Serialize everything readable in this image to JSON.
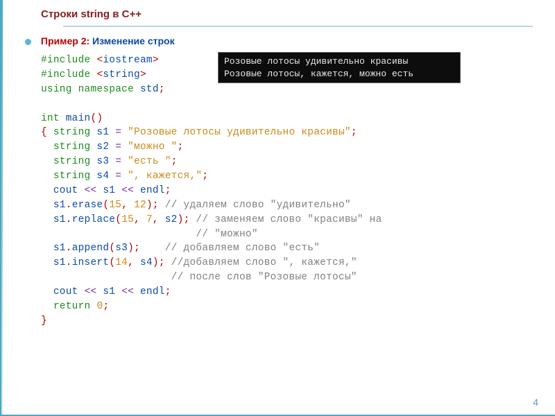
{
  "header": {
    "title": "Строки  string в С++"
  },
  "subtitle": {
    "label": "Пример 2:",
    "text": " Изменение строк"
  },
  "console": {
    "line1": "Розовые лотосы удивительно красивы",
    "line2": "Розовые лотосы, кажется, можно есть"
  },
  "code": {
    "l01_inc": "#include ",
    "l01_lt": "<",
    "l01_hdr": "iostream",
    "l01_gt": ">",
    "l02_inc": "#include ",
    "l02_lt": "<",
    "l02_hdr": "string",
    "l02_gt": ">",
    "l03_using": "using namespace ",
    "l03_std": "std",
    "l03_semi": ";",
    "l05_int": "int ",
    "l05_main": "main",
    "l05_paren": "()",
    "l06_br": "{ ",
    "l06_str": "string",
    "l06_s1": " s1 ",
    "l06_eq": "=",
    "l06_lit": " \"Розовые лотосы удивительно красивы\"",
    "l06_semi": ";",
    "l07_pad": "  ",
    "l07_str": "string",
    "l07_s2": " s2 ",
    "l07_eq": "=",
    "l07_lit": " \"можно \"",
    "l07_semi": ";",
    "l08_pad": "  ",
    "l08_str": "string",
    "l08_s3": " s3 ",
    "l08_eq": "=",
    "l08_lit": " \"есть \"",
    "l08_semi": ";",
    "l09_pad": "  ",
    "l09_str": "string",
    "l09_s4": " s4 ",
    "l09_eq": "=",
    "l09_lit": " \", кажется,\"",
    "l09_semi": ";",
    "l10_pad": "  ",
    "l10_cout": "cout ",
    "l10_op1": "<<",
    "l10_s1": " s1 ",
    "l10_op2": "<<",
    "l10_endl": " endl",
    "l10_semi": ";",
    "l11_pad": "  ",
    "l11_obj": "s1",
    "l11_dot": ".",
    "l11_fn": "erase",
    "l11_open": "(",
    "l11_a": "15",
    "l11_c": ", ",
    "l11_b": "12",
    "l11_close": ")",
    "l11_semi": ";",
    "l11_cmt": " // удаляем слово \"удивительно\"",
    "l12_pad": "  ",
    "l12_obj": "s1",
    "l12_dot": ".",
    "l12_fn": "replace",
    "l12_open": "(",
    "l12_a": "15",
    "l12_c1": ", ",
    "l12_b": "7",
    "l12_c2": ", ",
    "l12_s2": "s2",
    "l12_close": ")",
    "l12_semi": ";",
    "l12_cmt": " // заменяем слово \"красивы\" на",
    "l13_cmt": "                         // \"можно\"",
    "l14_pad": "  ",
    "l14_obj": "s1",
    "l14_dot": ".",
    "l14_fn": "append",
    "l14_open": "(",
    "l14_s3": "s3",
    "l14_close": ")",
    "l14_semi": ";",
    "l14_gap": "    ",
    "l14_cmt": "// добавляем слово \"есть\"",
    "l15_pad": "  ",
    "l15_obj": "s1",
    "l15_dot": ".",
    "l15_fn": "insert",
    "l15_open": "(",
    "l15_a": "14",
    "l15_c": ", ",
    "l15_s4": "s4",
    "l15_close": ")",
    "l15_semi": ";",
    "l15_cmt": " //добавляем слово \", кажется,\"",
    "l16_cmt": "                     // после слов \"Розовые лотосы\"",
    "l17_pad": "  ",
    "l17_cout": "cout ",
    "l17_op1": "<<",
    "l17_s1": " s1 ",
    "l17_op2": "<<",
    "l17_endl": " endl",
    "l17_semi": ";",
    "l18_pad": "  ",
    "l18_ret": "return ",
    "l18_zero": "0",
    "l18_semi": ";",
    "l19_br": "}"
  },
  "page_number": "4"
}
